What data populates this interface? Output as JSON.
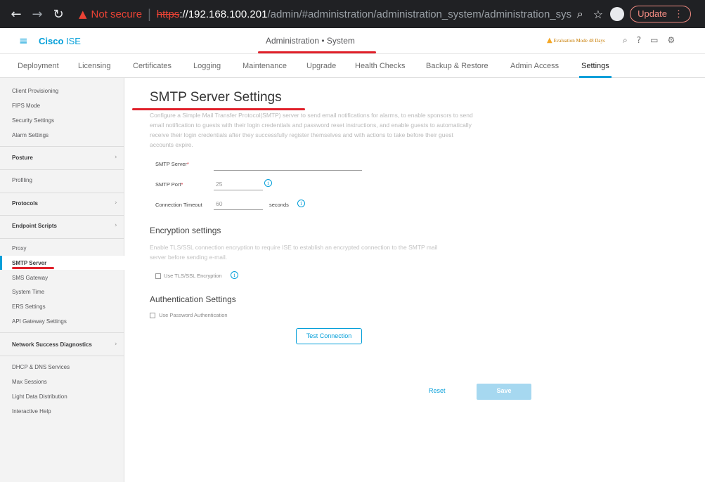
{
  "browser": {
    "back_glyph": "←",
    "forward_glyph": "→",
    "reload_glyph": "↻",
    "warning_glyph": "▲",
    "not_secure": "Not secure",
    "url_scheme": "https",
    "url_host": "://192.168.100.201",
    "url_path": "/admin/#administration/administration_system/administration_system_...",
    "zoom_glyph": "⌕",
    "star_glyph": "☆",
    "update_label": "Update",
    "menu_glyph": "⋮"
  },
  "header": {
    "menu_glyph": "≡",
    "brand_cisco": "Cisco",
    "brand_ise": " ISE",
    "page_title": "Administration • System",
    "eval_glyph": "▲",
    "eval_mode": "Evaluation Mode 48 Days",
    "icon_glyphs": {
      "search": "⌕",
      "help": "?",
      "dashboard": "▭",
      "settings": "⚙"
    }
  },
  "tabs": [
    {
      "label": "Deployment"
    },
    {
      "label": "Licensing"
    },
    {
      "label": "Certificates"
    },
    {
      "label": "Logging"
    },
    {
      "label": "Maintenance"
    },
    {
      "label": "Upgrade"
    },
    {
      "label": "Health Checks"
    },
    {
      "label": "Backup & Restore"
    },
    {
      "label": "Admin Access"
    },
    {
      "label": "Settings"
    }
  ],
  "sidebar": {
    "chevron_glyph": "›",
    "items": [
      {
        "label": "Client Provisioning"
      },
      {
        "label": "FIPS Mode"
      },
      {
        "label": "Security Settings"
      },
      {
        "label": "Alarm Settings"
      },
      {
        "label": "Posture"
      },
      {
        "label": "Profiling"
      },
      {
        "label": "Protocols"
      },
      {
        "label": "Endpoint Scripts"
      },
      {
        "label": "Proxy"
      },
      {
        "label": "SMTP Server"
      },
      {
        "label": "SMS Gateway"
      },
      {
        "label": "System Time"
      },
      {
        "label": "ERS Settings"
      },
      {
        "label": "API Gateway Settings"
      },
      {
        "label": "Network Success Diagnostics"
      },
      {
        "label": "DHCP & DNS Services"
      },
      {
        "label": "Max Sessions"
      },
      {
        "label": "Light Data Distribution"
      },
      {
        "label": "Interactive Help"
      }
    ]
  },
  "main": {
    "title": "SMTP Server Settings",
    "description": "Configure a Simple Mail Transfer Protocol(SMTP) server to send email notifications for alarms, to enable sponsors to send email notification to guests with their login credentials and password reset instructions, and enable guests to automatically receive their login credentials after they successfully register themselves and with actions to take before their guest accounts expire.",
    "required_mark": "*",
    "info_glyph": "i",
    "smtp_server_label": "SMTP Server",
    "smtp_server_value": "",
    "smtp_port_label": "SMTP Port",
    "smtp_port_value": "25",
    "timeout_label": "Connection Timeout",
    "timeout_value": "60",
    "timeout_units": "seconds",
    "encryption_heading": "Encryption settings",
    "encryption_desc": "Enable TLS/SSL connection encryption to require ISE to establish an encrypted connection to the SMTP mail server before sending e-mail.",
    "tls_label": "Use TLS/SSL Encryption",
    "auth_heading": "Authentication Settings",
    "password_auth_label": "Use Password Authentication",
    "test_connection_label": "Test Connection",
    "reset_label": "Reset",
    "save_label": "Save"
  },
  "colors": {
    "accent": "#049fd9",
    "annotation": "#e0202a",
    "save_disabled": "#a6d8f0"
  }
}
